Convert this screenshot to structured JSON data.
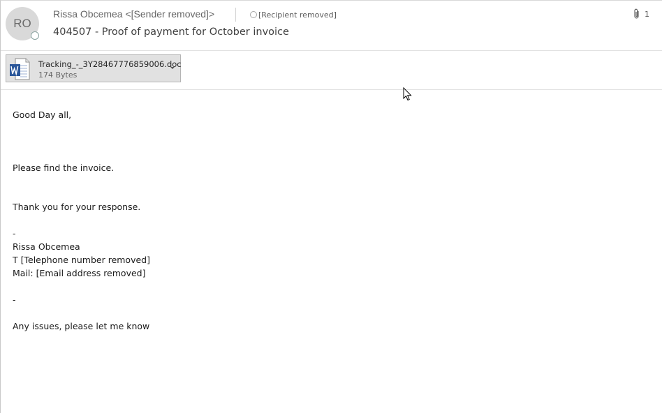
{
  "header": {
    "avatar_initials": "RO",
    "sender": "Rissa Obcemea <[Sender removed]>",
    "recipient": "[Recipient removed]",
    "subject": "404507 - Proof of payment for October invoice",
    "attachment_count": "1",
    "attachment_icon": "paperclip-icon"
  },
  "attachment": {
    "icon": "word-document-icon",
    "filename": "Tracking_-_3Y28467776859006.doc",
    "size": "174 Bytes"
  },
  "body": {
    "greeting": "Good Day all,",
    "line1": "Please find the invoice.",
    "line2": "Thank you for your response.",
    "dash1": "-",
    "sig_name": "Rissa Obcemea",
    "sig_phone": "T [Telephone number removed]",
    "sig_mail": "Mail: [Email address removed]",
    "dash2": "-",
    "closing": "Any issues, please let me know"
  },
  "colors": {
    "avatar_bg": "#d9d9d9",
    "word_blue": "#2b579a",
    "attachment_bg": "#e1e1e1"
  }
}
